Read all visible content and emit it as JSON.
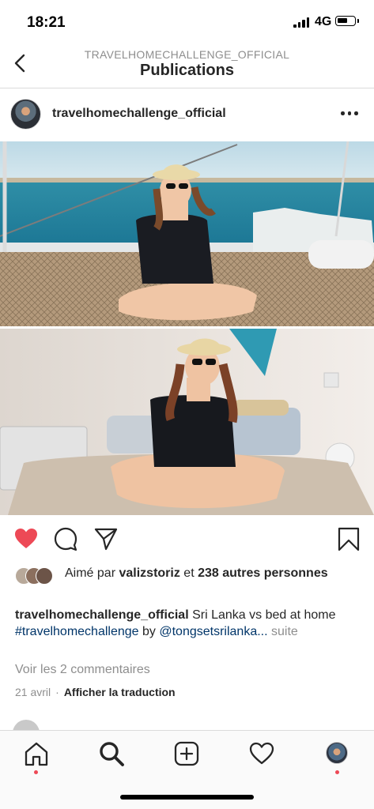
{
  "status_bar": {
    "time": "18:21",
    "network": "4G"
  },
  "header": {
    "subtitle": "TRAVELHOMECHALLENGE_OFFICIAL",
    "title": "Publications"
  },
  "post": {
    "username": "travelhomechallenge_official",
    "liked": true,
    "likes": {
      "prefix": "Aimé par",
      "first_liker": "valizstoriz",
      "joiner": "et",
      "others": "238 autres personnes"
    },
    "caption": {
      "username": "travelhomechallenge_official",
      "text": "Sri Lanka vs bed at home",
      "hashtag": "#travelhomechallenge",
      "by": "by",
      "mention": "@tongsetsrilanka...",
      "more": "suite"
    },
    "comments_link": "Voir les 2 commentaires",
    "date": "21 avril",
    "separator": "·",
    "translate": "Afficher la traduction"
  },
  "icons": {
    "back": "chevron-left-icon",
    "more": "more-horizontal-icon",
    "like": "heart-filled-icon",
    "comment": "comment-bubble-icon",
    "share": "paper-plane-icon",
    "save": "bookmark-icon",
    "tabs": [
      "home-icon",
      "search-icon",
      "add-post-icon",
      "activity-heart-icon",
      "profile-avatar"
    ]
  },
  "colors": {
    "like_red": "#ed4956",
    "link_blue": "#003569",
    "muted_gray": "#8e8e8e",
    "text": "#262626",
    "notification_dot": "#ed4956"
  }
}
